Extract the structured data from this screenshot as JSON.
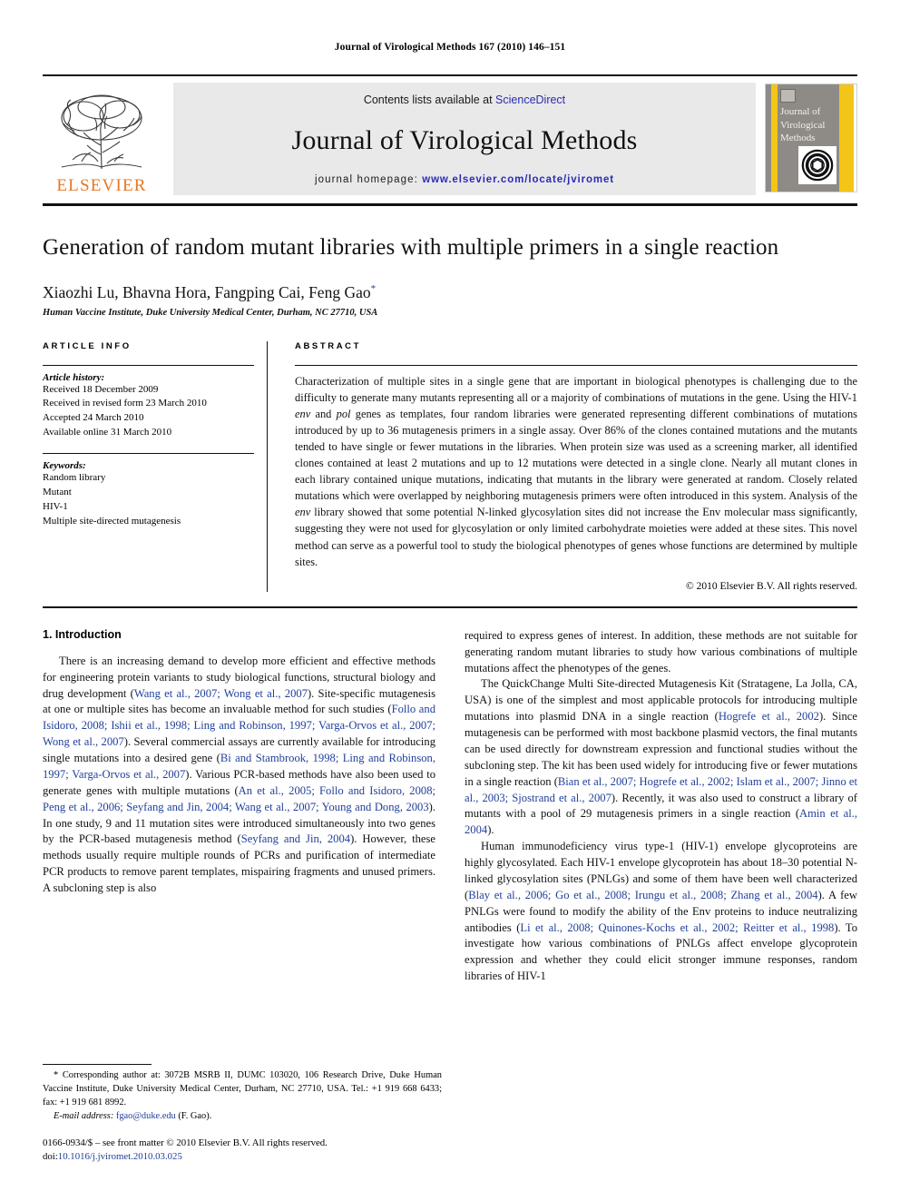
{
  "running_head": "Journal of Virological Methods 167 (2010) 146–151",
  "masthead": {
    "publisher_name": "ELSEVIER",
    "contents_prefix": "Contents lists available at ",
    "sciencedirect": "ScienceDirect",
    "journal_title": "Journal of Virological Methods",
    "homepage_prefix": "journal homepage: ",
    "homepage_url": "www.elsevier.com/locate/jviromet",
    "cover_title": "Journal of Virological Methods",
    "link_color": "#2b2bb5",
    "elsevier_orange": "#E87722",
    "cover_yellow": "#f3c518",
    "banner_gray": "#e9e9e9"
  },
  "article": {
    "title": "Generation of random mutant libraries with multiple primers in a single reaction",
    "authors": "Xiaozhi Lu, Bhavna Hora, Fangping Cai, Feng Gao",
    "corresponding_marker": "*",
    "affiliation": "Human Vaccine Institute, Duke University Medical Center, Durham, NC 27710, USA"
  },
  "info": {
    "heading": "ARTICLE INFO",
    "history_label": "Article history:",
    "history": [
      "Received 18 December 2009",
      "Received in revised form 23 March 2010",
      "Accepted 24 March 2010",
      "Available online 31 March 2010"
    ],
    "keywords_label": "Keywords:",
    "keywords": [
      "Random library",
      "Mutant",
      "HIV-1",
      "Multiple site-directed mutagenesis"
    ]
  },
  "abstract": {
    "heading": "ABSTRACT",
    "part1": "Characterization of multiple sites in a single gene that are important in biological phenotypes is challenging due to the difficulty to generate many mutants representing all or a majority of combinations of mutations in the gene. Using the HIV-1 ",
    "italic1": "env",
    "part2": " and ",
    "italic2": "pol",
    "part3": " genes as templates, four random libraries were generated representing different combinations of mutations introduced by up to 36 mutagenesis primers in a single assay. Over 86% of the clones contained mutations and the mutants tended to have single or fewer mutations in the libraries. When protein size was used as a screening marker, all identified clones contained at least 2 mutations and up to 12 mutations were detected in a single clone. Nearly all mutant clones in each library contained unique mutations, indicating that mutants in the library were generated at random. Closely related mutations which were overlapped by neighboring mutagenesis primers were often introduced in this system. Analysis of the ",
    "italic3": "env",
    "part4": " library showed that some potential N-linked glycosylation sites did not increase the Env molecular mass significantly, suggesting they were not used for glycosylation or only limited carbohydrate moieties were added at these sites. This novel method can serve as a powerful tool to study the biological phenotypes of genes whose functions are determined by multiple sites.",
    "copyright": "© 2010 Elsevier B.V. All rights reserved."
  },
  "introduction": {
    "heading": "1. Introduction",
    "left_p1_a": "There is an increasing demand to develop more efficient and effective methods for engineering protein variants to study biological functions, structural biology and drug development (",
    "left_p1_cite1": "Wang et al., 2007; Wong et al., 2007",
    "left_p1_b": "). Site-specific mutagenesis at one or multiple sites has become an invaluable method for such studies (",
    "left_p1_cite2": "Follo and Isidoro, 2008; Ishii et al., 1998; Ling and Robinson, 1997; Varga-Orvos et al., 2007; Wong et al., 2007",
    "left_p1_c": "). Several commercial assays are currently available for introducing single mutations into a desired gene (",
    "left_p1_cite3": "Bi and Stambrook, 1998; Ling and Robinson, 1997; Varga-Orvos et al., 2007",
    "left_p1_d": "). Various PCR-based methods have also been used to generate genes with multiple mutations (",
    "left_p1_cite4": "An et al., 2005; Follo and Isidoro, 2008; Peng et al., 2006; Seyfang and Jin, 2004; Wang et al., 2007; Young and Dong, 2003",
    "left_p1_e": "). In one study, 9 and 11 mutation sites were introduced simultaneously into two genes by the PCR-based mutagenesis method (",
    "left_p1_cite5": "Seyfang and Jin, 2004",
    "left_p1_f": "). However, these methods usually require multiple rounds of PCRs and purification of intermediate PCR products to remove parent templates, mispairing fragments and unused primers. A subcloning step is also",
    "right_p1": "required to express genes of interest. In addition, these methods are not suitable for generating random mutant libraries to study how various combinations of multiple mutations affect the phenotypes of the genes.",
    "right_p2_a": "The QuickChange Multi Site-directed Mutagenesis Kit (Stratagene, La Jolla, CA, USA) is one of the simplest and most applicable protocols for introducing multiple mutations into plasmid DNA in a single reaction (",
    "right_p2_cite1": "Hogrefe et al., 2002",
    "right_p2_b": "). Since mutagenesis can be performed with most backbone plasmid vectors, the final mutants can be used directly for downstream expression and functional studies without the subcloning step. The kit has been used widely for introducing five or fewer mutations in a single reaction (",
    "right_p2_cite2": "Bian et al., 2007; Hogrefe et al., 2002; Islam et al., 2007; Jinno et al., 2003; Sjostrand et al., 2007",
    "right_p2_c": "). Recently, it was also used to construct a library of mutants with a pool of 29 mutagenesis primers in a single reaction (",
    "right_p2_cite3": "Amin et al., 2004",
    "right_p2_d": ").",
    "right_p3_a": "Human immunodeficiency virus type-1 (HIV-1) envelope glycoproteins are highly glycosylated. Each HIV-1 envelope glycoprotein has about 18–30 potential N-linked glycosylation sites (PNLGs) and some of them have been well characterized (",
    "right_p3_cite1": "Blay et al., 2006; Go et al., 2008; Irungu et al., 2008; Zhang et al., 2004",
    "right_p3_b": "). A few PNLGs were found to modify the ability of the Env proteins to induce neutralizing antibodies (",
    "right_p3_cite2": "Li et al., 2008; Quinones-Kochs et al., 2002; Reitter et al., 1998",
    "right_p3_c": "). To investigate how various combinations of PNLGs affect envelope glycoprotein expression and whether they could elicit stronger immune responses, random libraries of HIV-1"
  },
  "footnotes": {
    "corresponding_marker": "*",
    "corresponding": " Corresponding author at: 3072B MSRB II, DUMC 103020, 106 Research Drive, Duke Human Vaccine Institute, Duke University Medical Center, Durham, NC 27710, USA. Tel.: +1 919 668 6433; fax: +1 919 681 8992.",
    "email_label": "E-mail address:",
    "email": "fgao@duke.edu",
    "email_suffix": " (F. Gao).",
    "issn_line": "0166-0934/$ – see front matter © 2010 Elsevier B.V. All rights reserved.",
    "doi_prefix": "doi:",
    "doi": "10.1016/j.jviromet.2010.03.025"
  }
}
